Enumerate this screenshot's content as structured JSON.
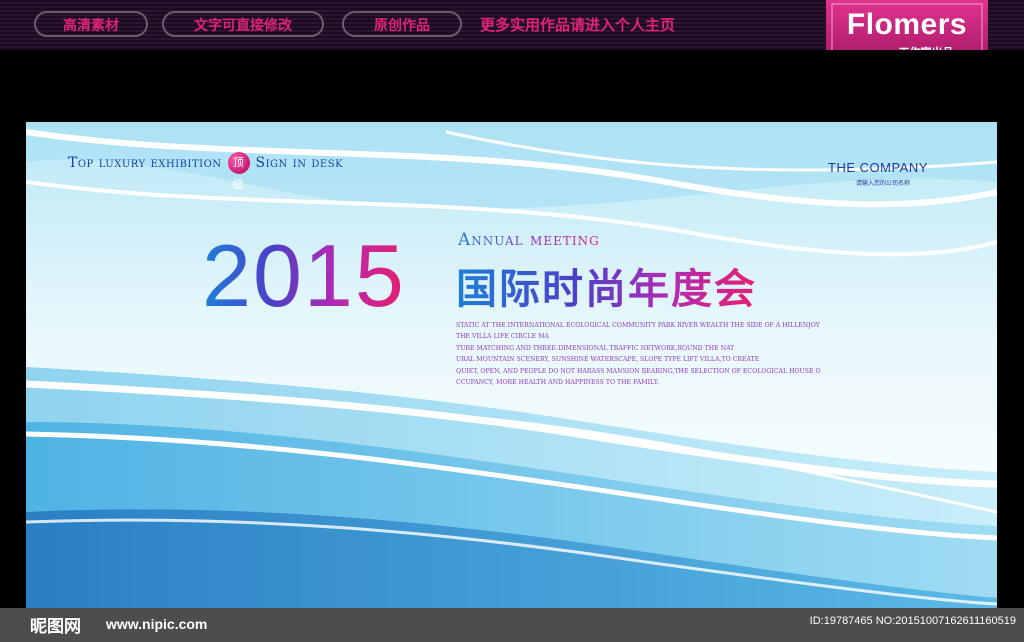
{
  "top_bar": {
    "pills": [
      "高清素材",
      "文字可直接修改",
      "原创作品"
    ],
    "promo": "更多实用作品请进入个人主页"
  },
  "badge": {
    "title": "Flomers",
    "subtitle": "工作室出品",
    "color": "#c41a78"
  },
  "poster": {
    "tagline_left": "Top luxury exhibition",
    "tagline_mark": "顶级",
    "tagline_right": "Sign in desk",
    "company": "THE COMPANY",
    "company_sub": "请输入您的公司名称",
    "year": "2015",
    "annual": "Annual meeting",
    "title_cn": "国际时尚年度会",
    "body_lines": [
      "static at the international ecological community park river wealth the side of a hillenjoy",
      "the villa life circle ma",
      "ture matching and three-dimensional traffic network,round the nat",
      "ural mountain scenery, sunshine waterscape, slope type lift villa,to create",
      "quiet, open, and people do not harass mansion bearing,the selection of ecological house o",
      "ccupancy, more health and happiness to the family."
    ]
  },
  "footer": {
    "site_cn": "昵图网",
    "site_url": "www.nipic.com",
    "image_id": "ID:19787465 NO:20151007162611160519"
  }
}
